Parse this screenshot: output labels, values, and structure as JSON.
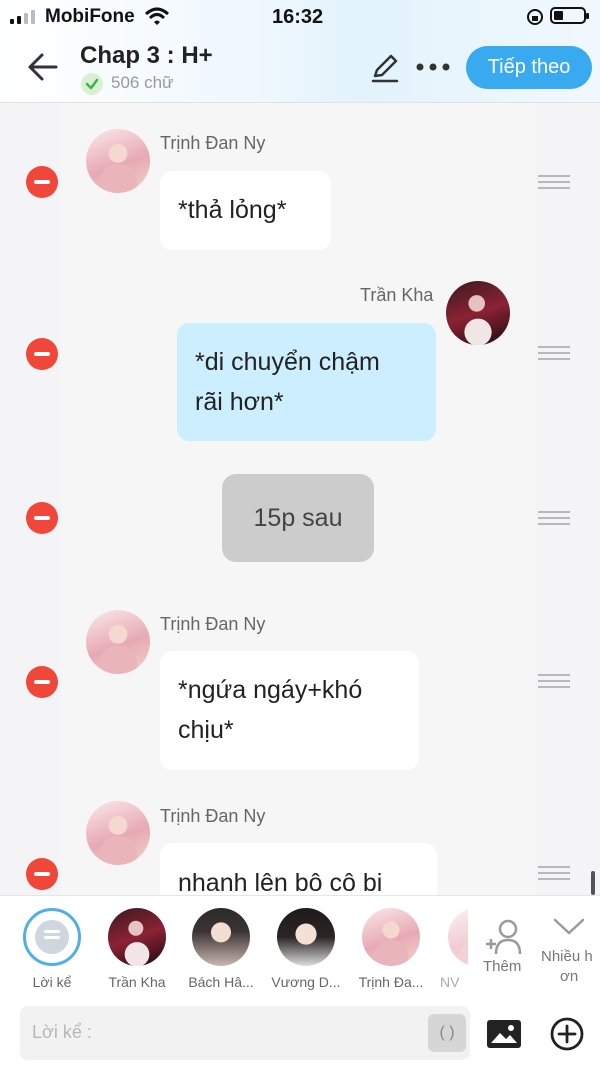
{
  "status_bar": {
    "carrier": "MobiFone",
    "time": "16:32"
  },
  "header": {
    "title": "Chap 3 : H+",
    "word_count": "506 chữ",
    "next_button": "Tiếp theo",
    "icons": [
      "back-arrow-icon",
      "pencil-icon",
      "more-dots-icon",
      "check-circle-icon"
    ]
  },
  "messages": [
    {
      "sender": "Trịnh Đan Ny",
      "text": "*thả lỏng*",
      "side": "left",
      "style": "white"
    },
    {
      "sender": "Trần Kha",
      "text_lines": [
        "*di chuyển chậm",
        "rãi hơn*"
      ],
      "side": "right",
      "style": "blue"
    },
    {
      "text": "15p sau",
      "style": "narration"
    },
    {
      "sender": "Trịnh Đan Ny",
      "text_lines": [
        "*ngứa ngáy+khó",
        "chịu*"
      ],
      "side": "left",
      "style": "white"
    },
    {
      "sender": "Trịnh Đan Ny",
      "text": "nhanh lên bô cô bi",
      "side": "left",
      "style": "white"
    }
  ],
  "characters": [
    {
      "label": "Lời kể"
    },
    {
      "label": "Trần Kha"
    },
    {
      "label": "Bách Hâ..."
    },
    {
      "label": "Vương D..."
    },
    {
      "label": "Trịnh Đa..."
    },
    {
      "label": "NV"
    }
  ],
  "more_actions": {
    "add_label": "Thêm",
    "many_label_line1": "Nhiều h",
    "many_label_line2": "ơn"
  },
  "input": {
    "placeholder": "Lời kể :",
    "paren_button": "( )"
  },
  "colors": {
    "accent": "#3aaaf0",
    "delete": "#f1463a",
    "right_bubble": "#cdeefe",
    "narration_bubble": "#cccccc"
  }
}
